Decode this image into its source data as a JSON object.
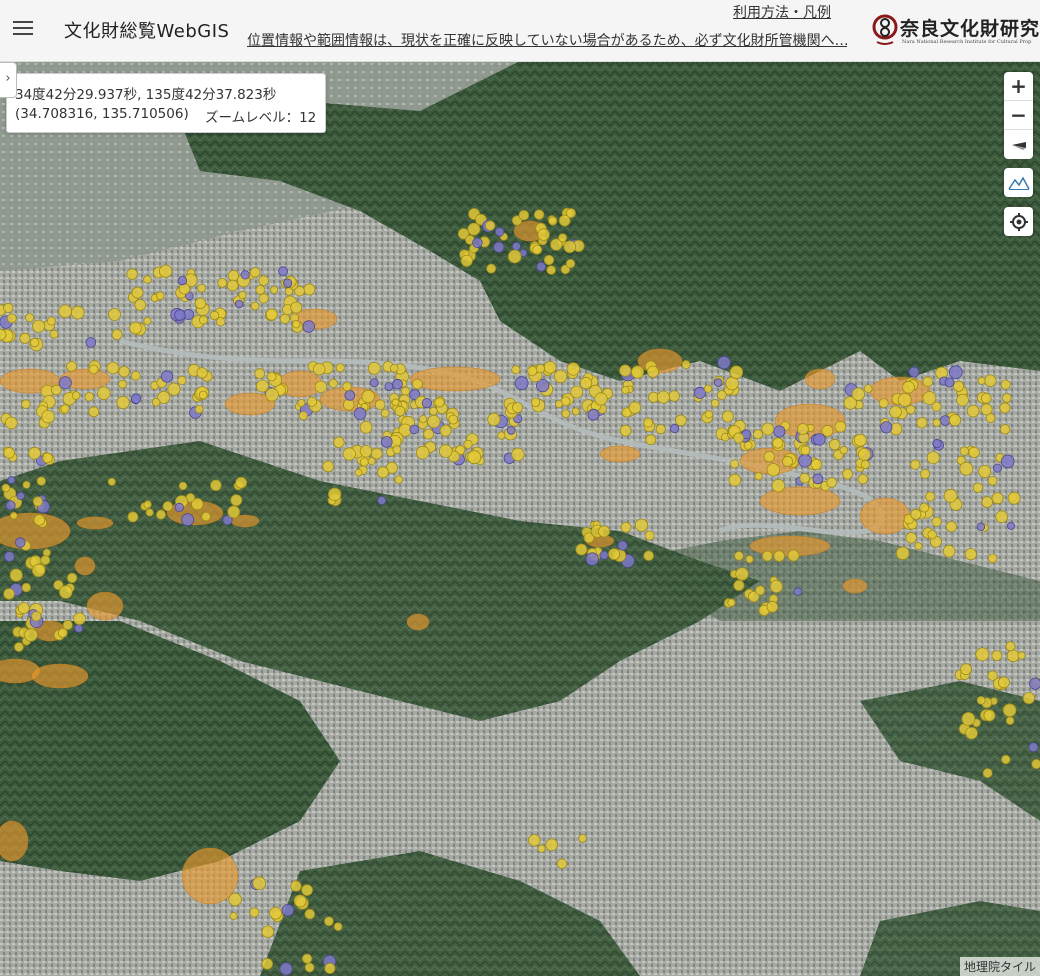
{
  "header": {
    "app_title": "文化財総覧WebGIS",
    "usage_link": "利用方法・凡例",
    "notice_link": "位置情報や範囲情報は、現状を正確に反映していない場合があるため、必ず文化財所管機関へ…",
    "logo_text": "奈良文化財研究",
    "logo_subtext": "Nara National Research Institute for Cultural Prop"
  },
  "coords": {
    "dms": "34度42分29.937秒, 135度42分37.823秒",
    "decimal": "(34.708316, 135.710506)",
    "zoom_label": "ズームレベル：12"
  },
  "controls": {
    "zoom_in": "+",
    "zoom_out": "−"
  },
  "attribution": "地理院タイル",
  "colors": {
    "site_point": "#e2c93a",
    "site_point_alt": "#7e79c8",
    "site_area": "#e89a2e",
    "forest": "#3d5a3e",
    "urban": "#9a9e9a",
    "river": "#b8c0c0"
  }
}
